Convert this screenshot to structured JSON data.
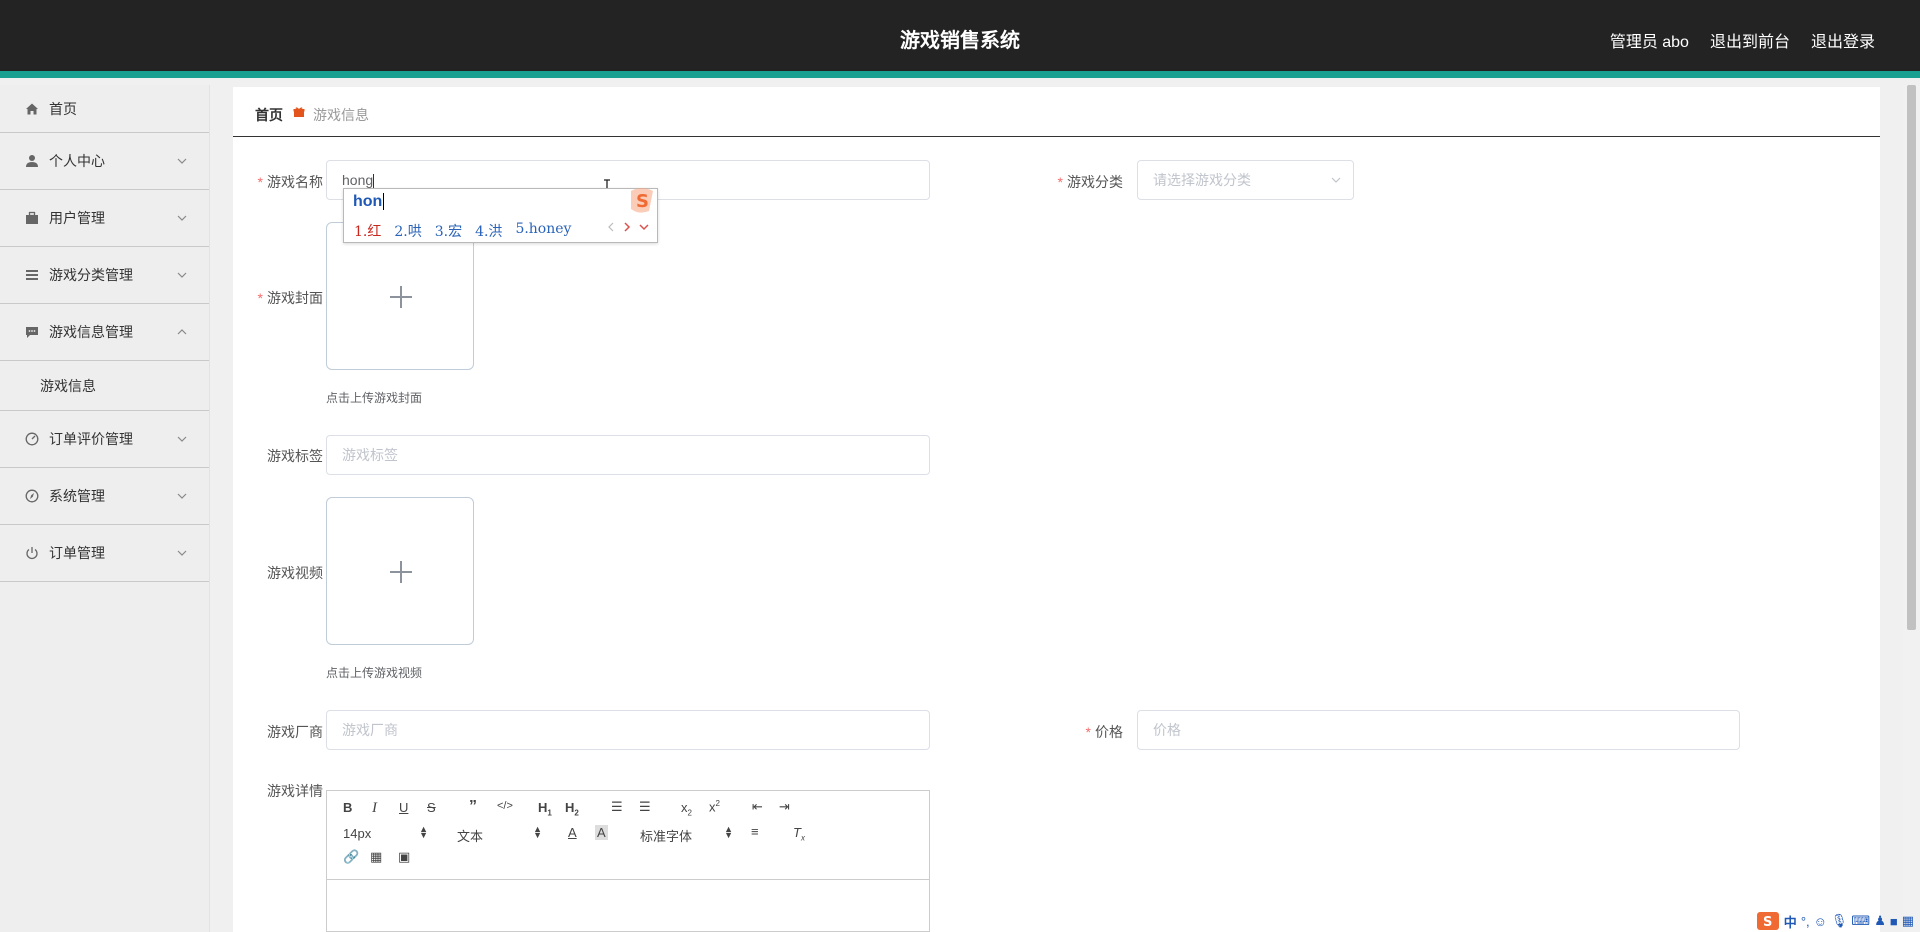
{
  "header": {
    "title": "游戏销售系统",
    "user_label": "管理员 abo",
    "frontend_link": "退出到前台",
    "logout_link": "退出登录",
    "accent_color": "#1aa091"
  },
  "sidebar": {
    "items": [
      {
        "label": "首页",
        "icon": "home-icon"
      },
      {
        "label": "个人中心",
        "icon": "user-icon"
      },
      {
        "label": "用户管理",
        "icon": "briefcase-icon"
      },
      {
        "label": "游戏分类管理",
        "icon": "list-icon"
      },
      {
        "label": "游戏信息管理",
        "icon": "chat-icon",
        "expanded": true
      },
      {
        "label": "游戏信息",
        "submenu": true
      },
      {
        "label": "订单评价管理",
        "icon": "gauge-icon"
      },
      {
        "label": "系统管理",
        "icon": "compass-icon"
      },
      {
        "label": "订单管理",
        "icon": "power-icon"
      }
    ]
  },
  "breadcrumb": {
    "home": "首页",
    "current": "游戏信息"
  },
  "form": {
    "name_label": "游戏名称",
    "name_value": "hong",
    "category_label": "游戏分类",
    "category_placeholder": "请选择游戏分类",
    "cover_label": "游戏封面",
    "cover_hint": "点击上传游戏封面",
    "tags_label": "游戏标签",
    "tags_placeholder": "游戏标签",
    "video_label": "游戏视频",
    "video_hint": "点击上传游戏视频",
    "vendor_label": "游戏厂商",
    "vendor_placeholder": "游戏厂商",
    "price_label": "价格",
    "price_placeholder": "价格",
    "detail_label": "游戏详情"
  },
  "ime": {
    "composition": "hon",
    "candidates": [
      "1.红",
      "2.哄",
      "3.宏",
      "4.洪",
      "5.honey"
    ]
  },
  "editor": {
    "font_size": "14px",
    "header_select": "文本",
    "font_family": "标准字体"
  },
  "tray": {
    "mode": "中"
  }
}
